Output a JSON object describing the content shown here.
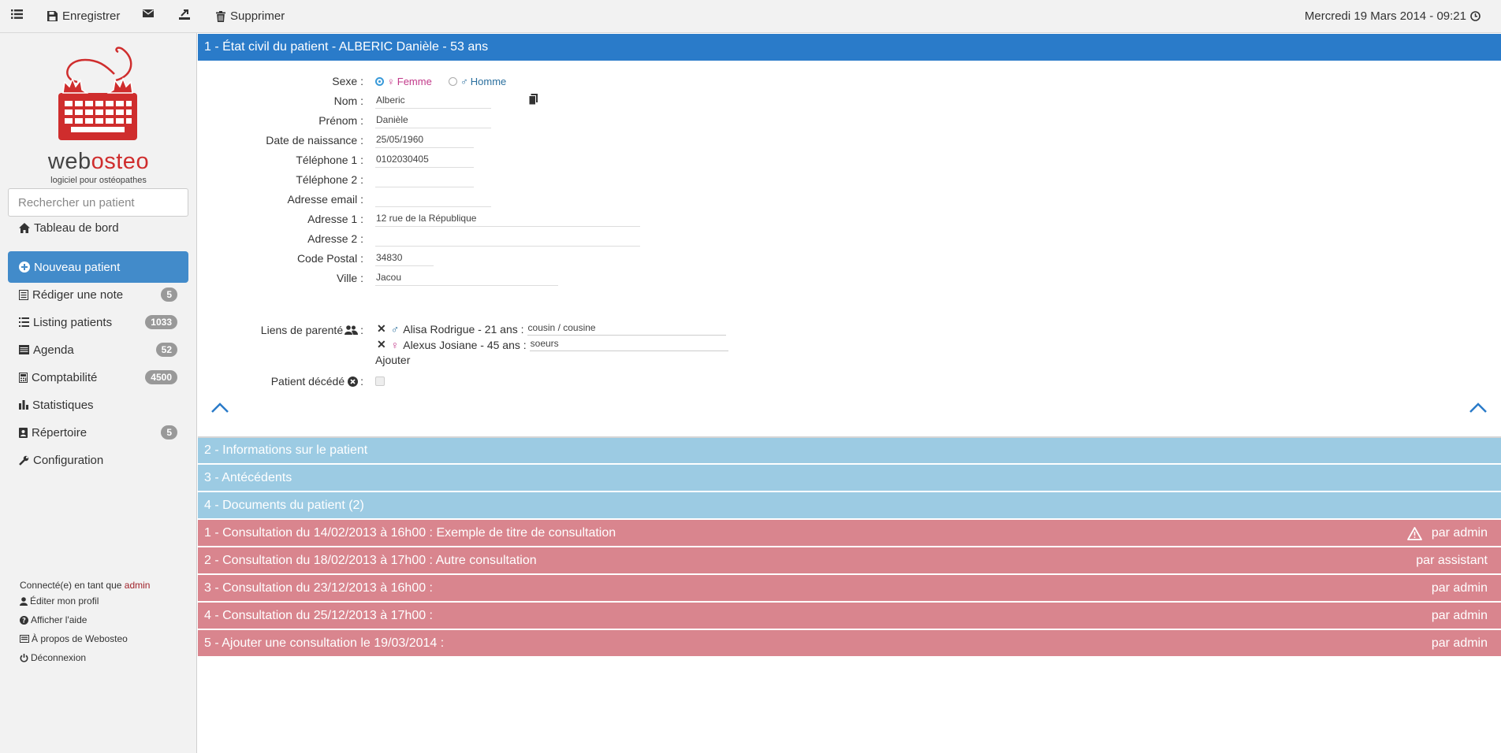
{
  "toolbar": {
    "save_label": "Enregistrer",
    "delete_label": "Supprimer",
    "datetime": "Mercredi 19 Mars 2014 - 09:21"
  },
  "brand": {
    "name_part1": "web",
    "name_part2": "osteo",
    "tagline": "logiciel pour ostéopathes"
  },
  "search": {
    "placeholder": "Rechercher un patient"
  },
  "nav": [
    {
      "label": "Tableau de bord",
      "icon": "home-icon"
    },
    {
      "label": "Nouveau patient",
      "icon": "plus-circle-icon",
      "active": true
    },
    {
      "label": "Rédiger une note",
      "icon": "note-icon",
      "badge": "5"
    },
    {
      "label": "Listing patients",
      "icon": "list-icon",
      "badge": "1033"
    },
    {
      "label": "Agenda",
      "icon": "calendar-icon",
      "badge": "52"
    },
    {
      "label": "Comptabilité",
      "icon": "calculator-icon",
      "badge": "4500"
    },
    {
      "label": "Statistiques",
      "icon": "bar-chart-icon"
    },
    {
      "label": "Répertoire",
      "icon": "address-book-icon",
      "badge": "5"
    },
    {
      "label": "Configuration",
      "icon": "wrench-icon"
    }
  ],
  "account": {
    "connected_prefix": "Connecté(e) en tant que",
    "username": "admin",
    "links": [
      "Éditer mon profil",
      "Afficher l'aide",
      "À propos de Webosteo",
      "Déconnexion"
    ]
  },
  "section1": {
    "title": "1 - État civil du patient - ALBERIC Danièle - 53 ans",
    "sex_label": "Sexe :",
    "sex_female": "Femme",
    "sex_male": "Homme",
    "sex_selected": "Femme",
    "fields": [
      {
        "label": "Nom :",
        "value": "Alberic"
      },
      {
        "label": "Prénom :",
        "value": "Danièle"
      },
      {
        "label": "Date de naissance :",
        "value": "25/05/1960"
      },
      {
        "label": "Téléphone 1 :",
        "value": "0102030405"
      },
      {
        "label": "Téléphone 2 :",
        "value": ""
      },
      {
        "label": "Adresse email :",
        "value": ""
      },
      {
        "label": "Adresse 1 :",
        "value": "12 rue de la République"
      },
      {
        "label": "Adresse 2 :",
        "value": ""
      },
      {
        "label": "Code Postal :",
        "value": "34830"
      },
      {
        "label": "Ville :",
        "value": "Jacou"
      }
    ],
    "relations_label": "Liens de parenté",
    "relations_colon": ":",
    "relations": [
      {
        "name": "Alisa Rodrigue - 21 ans :",
        "relation": "cousin / cousine",
        "sex": "male"
      },
      {
        "name": "Alexus Josiane - 45 ans :",
        "relation": "soeurs",
        "sex": "female"
      }
    ],
    "add_label": "Ajouter",
    "deceased_label": "Patient décédé",
    "deceased_colon": ":",
    "deceased": false
  },
  "sections": [
    {
      "title": "2 - Informations sur le patient",
      "style": "light"
    },
    {
      "title": "3 - Antécédents",
      "style": "light"
    },
    {
      "title": "4 - Documents du patient (2)",
      "style": "light"
    }
  ],
  "consultations": [
    {
      "title": "1 - Consultation du 14/02/2013 à 16h00 : Exemple de titre de consultation",
      "author": "par admin",
      "warning": true
    },
    {
      "title": "2 - Consultation du 18/02/2013 à 17h00 : Autre consultation",
      "author": "par assistant",
      "warning": false
    },
    {
      "title": "3 - Consultation du 23/12/2013 à 16h00 :",
      "author": "par admin",
      "warning": false
    },
    {
      "title": "4 - Consultation du 25/12/2013 à 17h00 :",
      "author": "par admin",
      "warning": false
    },
    {
      "title": "5 - Ajouter une consultation le 19/03/2014 :",
      "author": "par admin",
      "warning": false
    }
  ],
  "colors": {
    "primary": "#2a7bc9",
    "nav_active": "#428bca",
    "section_light": "#9ccbe3",
    "consultation": "#d9858e",
    "female": "#c2398a",
    "male": "#2a6f9e",
    "username": "#a0222a"
  }
}
